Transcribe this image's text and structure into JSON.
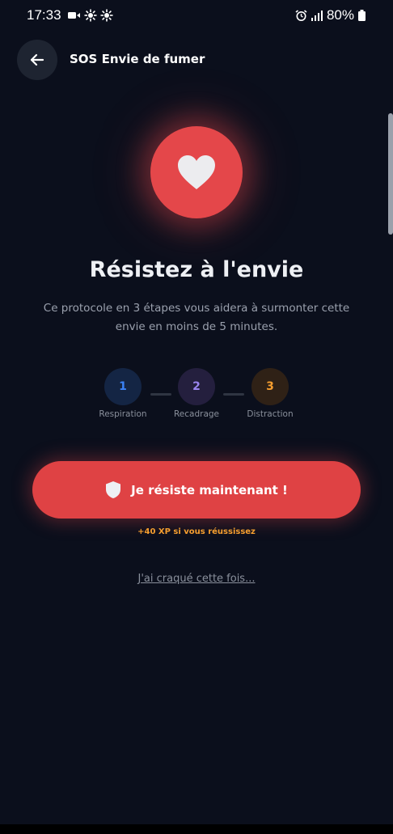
{
  "status_bar": {
    "time": "17:33",
    "battery": "80%",
    "icons": [
      "video-icon",
      "sun-icon",
      "sun-icon",
      "alarm-icon",
      "signal-icon",
      "battery-icon"
    ]
  },
  "header": {
    "title": "SOS Envie de fumer",
    "back_icon": "arrow-left-icon"
  },
  "hero": {
    "icon": "heart-icon",
    "title": "Résistez à l'envie",
    "description": "Ce protocole en 3 étapes vous aidera à surmonter cette envie en moins de 5 minutes."
  },
  "steps": [
    {
      "number": "1",
      "label": "Respiration",
      "color": "#3b82f6"
    },
    {
      "number": "2",
      "label": "Recadrage",
      "color": "#9a85f0"
    },
    {
      "number": "3",
      "label": "Distraction",
      "color": "#f59e2f"
    }
  ],
  "cta": {
    "icon": "shield-icon",
    "label": "Je résiste maintenant !",
    "xp_note": "+40 XP si vous réussissez"
  },
  "secondary_link": "J'ai craqué cette fois...",
  "colors": {
    "background": "#0b0f1c",
    "accent_red": "#df4244",
    "accent_orange": "#f59e2f"
  }
}
